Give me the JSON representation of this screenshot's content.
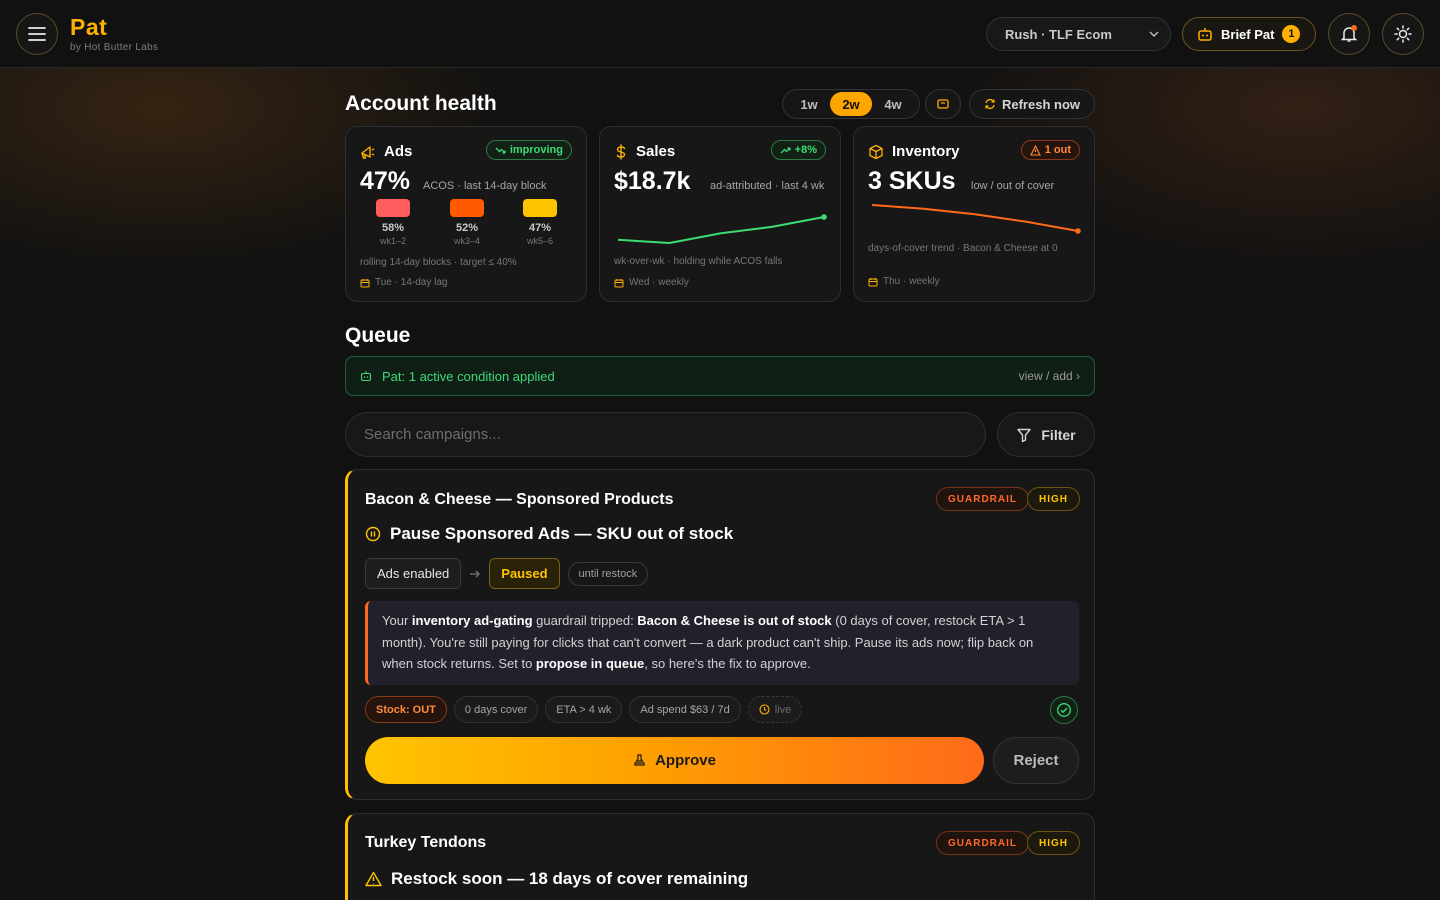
{
  "brand": {
    "name": "Pat",
    "subtitle": "by Hot Butter Labs"
  },
  "header": {
    "account": "Rush · TLF Ecom",
    "brief_label": "Brief Pat",
    "brief_count": "1",
    "icons": {
      "menu": "hamburger-menu-icon",
      "brief": "robot-icon",
      "notifications": "bell-icon",
      "theme": "sun-icon"
    }
  },
  "health": {
    "title": "Account health",
    "ranges": [
      "1w",
      "2w",
      "4w"
    ],
    "active_range": "2w",
    "refresh_label": "Refresh now",
    "cards": {
      "ads": {
        "title": "Ads",
        "pill": "improving",
        "value": "47%",
        "note": "ACOS · last 14-day block",
        "blocks": [
          {
            "pct": "58%",
            "label": "wk1–2",
            "color": "#ff5e5e",
            "value": 58
          },
          {
            "pct": "52%",
            "label": "wk3–4",
            "color": "#ff5a00",
            "value": 52
          },
          {
            "pct": "47%",
            "label": "wk5–6",
            "color": "#ffc400",
            "value": 47
          }
        ],
        "footnote": "rolling 14-day blocks · target ≤ 40%",
        "schedule": "Tue · 14-day lag"
      },
      "sales": {
        "title": "Sales",
        "pill": "+8%",
        "value": "$18.7k",
        "note": "ad-attributed · last 4 wk",
        "trend": [
          12,
          11,
          14,
          16,
          19
        ],
        "footnote": "wk-over-wk · holding while ACOS falls",
        "schedule": "Wed · weekly"
      },
      "inventory": {
        "title": "Inventory",
        "pill": "1 out",
        "value": "3 SKUs",
        "note": "low / out of cover",
        "trend": [
          22,
          20,
          17,
          13,
          8
        ],
        "footnote": "days-of-cover trend · Bacon & Cheese at 0",
        "schedule": "Thu · weekly"
      }
    }
  },
  "queue": {
    "title": "Queue",
    "condition": "Pat: 1 active condition applied",
    "condition_link": "view / add ›",
    "search_placeholder": "Search campaigns...",
    "filter_label": "Filter",
    "items": [
      {
        "campaign": "Bacon & Cheese — Sponsored Products",
        "tags": [
          "GUARDRAIL",
          "HIGH"
        ],
        "action": "Pause Sponsored Ads — SKU out of stock",
        "from_state": "Ads enabled",
        "to_state": "Paused",
        "state_note": "until restock",
        "explain": {
          "p1": "Your ",
          "b1": "inventory ad-gating",
          "p2": " guardrail tripped: ",
          "b2": "Bacon & Cheese is out of stock",
          "p3": " (0 days of cover, restock ETA > 1 month). You're still paying for clicks that can't convert — a dark product can't ship. Pause its ads now; flip back on when stock returns. Set to ",
          "b3": "propose in queue",
          "p4": ", so here's the fix to approve."
        },
        "chips": [
          "Stock: OUT",
          "0 days cover",
          "ETA > 4 wk",
          "Ad spend $63 / 7d",
          "live"
        ],
        "approve_label": "Approve",
        "reject_label": "Reject"
      },
      {
        "campaign": "Turkey Tendons",
        "tags": [
          "GUARDRAIL",
          "HIGH"
        ],
        "action": "Restock soon — 18 days of cover remaining"
      }
    ]
  },
  "colors": {
    "accent": "#ffb000",
    "green": "#3ddc72",
    "orange": "#ff6a1a",
    "yellow": "#ffc400"
  }
}
